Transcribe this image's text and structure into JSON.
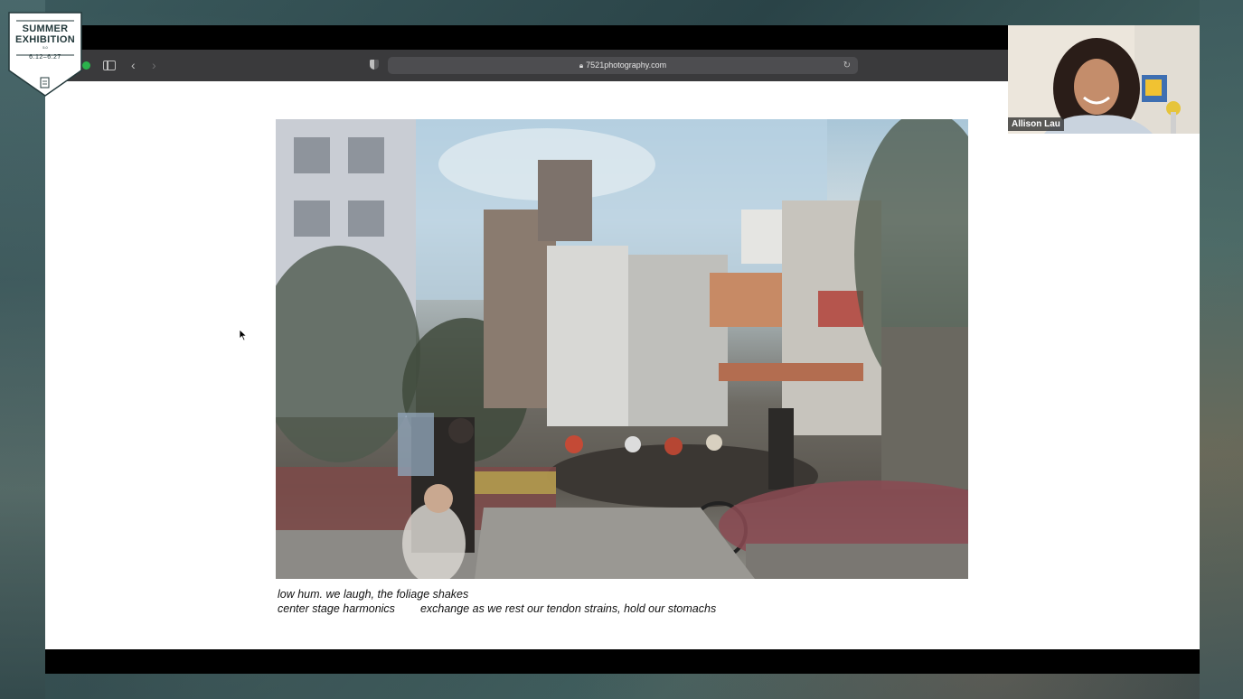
{
  "exhibition_badge": {
    "title_line1": "SUMMER",
    "title_line2": "EXHIBITION",
    "version": "5.0",
    "dates": "6.12–6.27"
  },
  "browser": {
    "url": "7521photography.com",
    "icons": [
      "traffic-light-icon",
      "sidebar-icon",
      "back-icon",
      "forward-icon",
      "privacy-shield-icon",
      "lock-icon",
      "reload-icon"
    ]
  },
  "page": {
    "caption_line1": "low hum. we laugh, the foliage shakes",
    "caption_line2_part1": "center stage harmonics",
    "caption_line2_part2": "exchange as we rest our tendon strains, hold our stomachs"
  },
  "participant": {
    "name": "Allison Lau"
  },
  "colors": {
    "background": "#2f4a4e",
    "browser_toolbar": "#3a3a3c",
    "page": "#ffffff"
  }
}
